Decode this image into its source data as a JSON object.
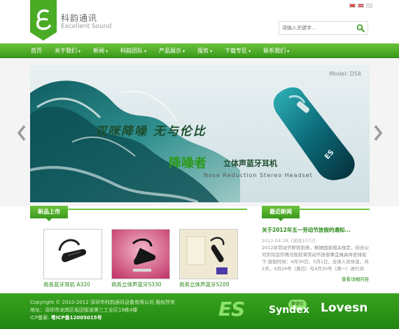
{
  "header": {
    "brand_cn": "科韵通讯",
    "brand_en": "Excellent Sound",
    "search_placeholder": "请输入关键字..."
  },
  "nav": {
    "items": [
      {
        "label": "首页",
        "caret": ""
      },
      {
        "label": "关于我们",
        "caret": "▾"
      },
      {
        "label": "新闻",
        "caret": "▾"
      },
      {
        "label": "科韵团队",
        "caret": "▾"
      },
      {
        "label": "产品展示",
        "caret": "▾"
      },
      {
        "label": "服务",
        "caret": "▾"
      },
      {
        "label": "下载专区",
        "caret": "▾"
      },
      {
        "label": "联系我们",
        "caret": "▾"
      }
    ]
  },
  "banner": {
    "model": "Model: D58",
    "slogan1": "双咪降噪  无与伦比",
    "slogan2": "降噪者",
    "slogan2_sub": "立体声蓝牙耳机",
    "slogan3": "Nose Reduction Stereo Headset",
    "product_logo": "ES"
  },
  "sections": {
    "products_title": "新品上市",
    "news_title": "最近新闻"
  },
  "products": [
    {
      "caption": "商务蓝牙耳机 A320"
    },
    {
      "caption": "商务立体声蓝牙S330"
    },
    {
      "caption": "商务立体声蓝牙S209"
    }
  ],
  "news": {
    "title": "关于2012年五一劳动节放假的通知...",
    "date": "2012-04-28, [阅读1072]",
    "body": "2012年劳动节即将到来，根据国家相关规定，结合公司实际运作情况现就将劳动节放假事宜做具体安排如下:放假时间：4月30日、5月1日，全体人员休息，共2天。4月29号（周日）与4月30号（周一）进行对",
    "more": "查看详细内容"
  },
  "footer": {
    "copyright": "Copyright © 2010-2012 深圳市科韵通讯设备有限公司 版权所有",
    "address": "地址：深圳市龙岗区坂田街道第三工业区19栋4楼",
    "icp_label": "ICP备案:",
    "icp_num": "粤ICP备12005015号",
    "logo_es": "ES",
    "logo_syndex": "Syndex",
    "logo_syndex_badge": "赛德仕",
    "logo_lovesn": "Lovesn"
  },
  "colors": {
    "brand_green": "#3a9a1c",
    "nav_light": "#6cc33b",
    "footer_green": "#2a951a"
  }
}
